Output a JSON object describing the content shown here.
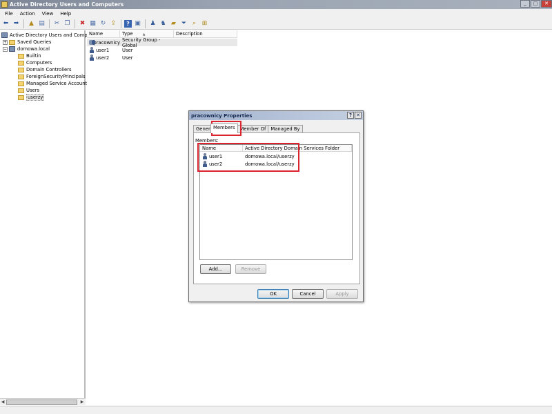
{
  "window": {
    "title": "Active Directory Users and Computers",
    "min": "_",
    "max": "□",
    "close": "✕"
  },
  "menu": [
    "File",
    "Action",
    "View",
    "Help"
  ],
  "toolbar": {
    "icons": [
      "back-arrow-icon",
      "forward-arrow-icon",
      "up-folder-icon",
      "show-tree-icon",
      "cut-icon",
      "copy-icon",
      "delete-icon",
      "properties-icon",
      "refresh-icon",
      "export-icon",
      "help-icon",
      "console-icon",
      "new-user-icon",
      "new-group-icon",
      "new-ou-icon",
      "filter-icon",
      "find-icon",
      "add-to-group-icon"
    ]
  },
  "tree": {
    "root": "Active Directory Users and Comput",
    "saved_queries": "Saved Queries",
    "domain": "domowa.local",
    "children": [
      "Builtin",
      "Computers",
      "Domain Controllers",
      "ForeignSecurityPrincipals",
      "Managed Service Accounts",
      "Users",
      "userzy"
    ]
  },
  "list": {
    "headers": [
      "Name",
      "Type",
      "Description"
    ],
    "sort_indicator": "▲",
    "rows": [
      {
        "name": "pracownicy",
        "type": "Security Group - Global",
        "description": ""
      },
      {
        "name": "user1",
        "type": "User",
        "description": ""
      },
      {
        "name": "user2",
        "type": "User",
        "description": ""
      }
    ]
  },
  "dialog": {
    "title": "pracownicy Properties",
    "help_btn": "?",
    "close_btn": "✕",
    "tabs": [
      "General",
      "Members",
      "Member Of",
      "Managed By"
    ],
    "members_label": "Members:",
    "columns": [
      "Name",
      "Active Directory Domain Services Folder"
    ],
    "members": [
      {
        "name": "user1",
        "folder": "domowa.local/userzy"
      },
      {
        "name": "user2",
        "folder": "domowa.local/userzy"
      }
    ],
    "add_btn": "Add...",
    "remove_btn": "Remove",
    "ok_btn": "OK",
    "cancel_btn": "Cancel",
    "apply_btn": "Apply"
  },
  "highlight_color": "#d9232e"
}
